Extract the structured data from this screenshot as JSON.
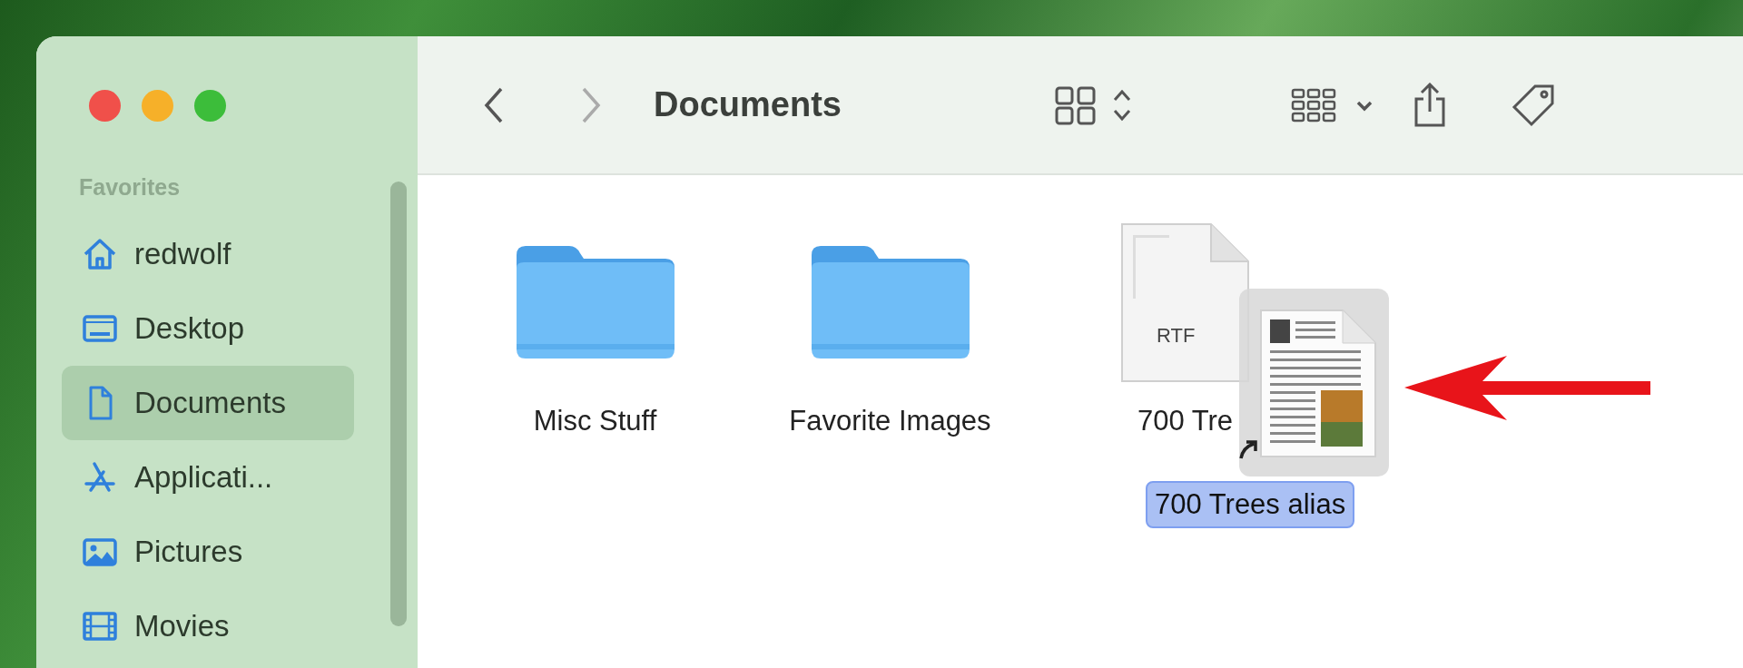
{
  "window": {
    "title": "Documents"
  },
  "sidebar": {
    "section": "Favorites",
    "items": [
      {
        "label": "redwolf",
        "kind": "home",
        "selected": false
      },
      {
        "label": "Desktop",
        "kind": "desktop",
        "selected": false
      },
      {
        "label": "Documents",
        "kind": "document",
        "selected": true
      },
      {
        "label": "Applicati...",
        "kind": "apps",
        "selected": false
      },
      {
        "label": "Pictures",
        "kind": "pictures",
        "selected": false
      },
      {
        "label": "Movies",
        "kind": "movies",
        "selected": false
      }
    ]
  },
  "files": [
    {
      "name": "Misc Stuff",
      "kind": "folder"
    },
    {
      "name": "Favorite Images",
      "kind": "folder"
    },
    {
      "name": "700 Tre",
      "kind": "rtf",
      "badge": "RTF"
    }
  ],
  "dragged_alias": {
    "name": "700 Trees alias",
    "selected": true
  }
}
